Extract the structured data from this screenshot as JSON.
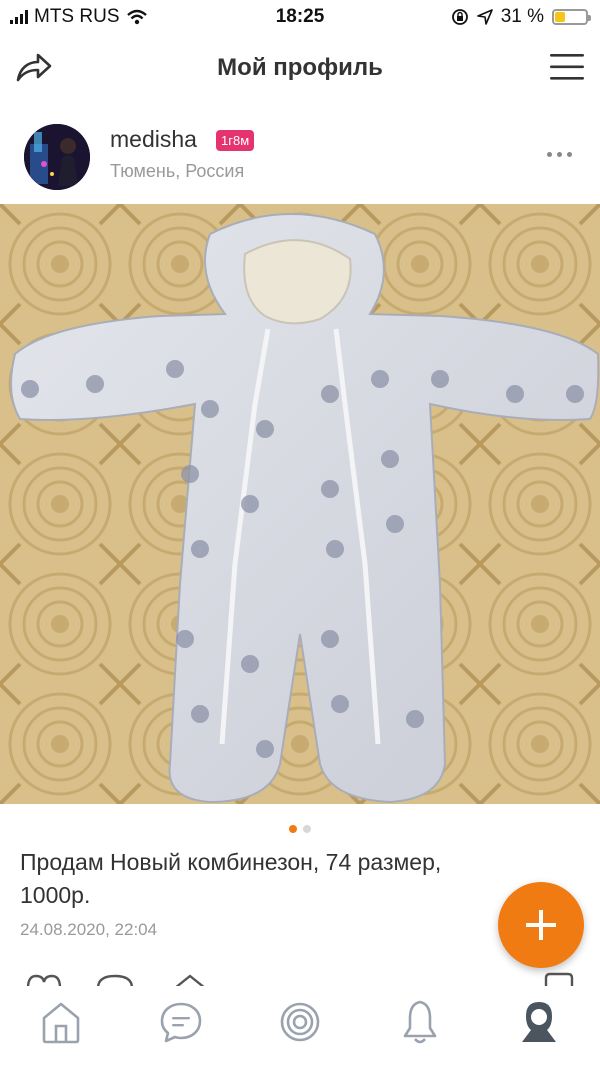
{
  "status_bar": {
    "carrier": "MTS RUS",
    "time": "18:25",
    "battery": "31 %",
    "battery_level": 0.31
  },
  "nav": {
    "title": "Мой профиль",
    "share_icon": "share-icon",
    "menu_icon": "menu-icon"
  },
  "profile": {
    "username": "medisha",
    "badge": "1г8м",
    "location": "Тюмень, Россия"
  },
  "post": {
    "text": "Продам Новый комбинезон, 74 размер, 1000р.",
    "date": "24.08.2020, 22:04",
    "pager": {
      "count": 2,
      "active": 0
    }
  },
  "tabs": [
    {
      "name": "home",
      "icon": "home-icon"
    },
    {
      "name": "messages",
      "icon": "chat-icon"
    },
    {
      "name": "feed",
      "icon": "target-icon"
    },
    {
      "name": "notifications",
      "icon": "bell-icon"
    },
    {
      "name": "profile",
      "icon": "profile-icon"
    }
  ],
  "colors": {
    "accent": "#f07b12",
    "badge": "#e5336f",
    "muted": "#999999",
    "icon": "#9aa3ad",
    "active_tab": "#4a5560"
  }
}
